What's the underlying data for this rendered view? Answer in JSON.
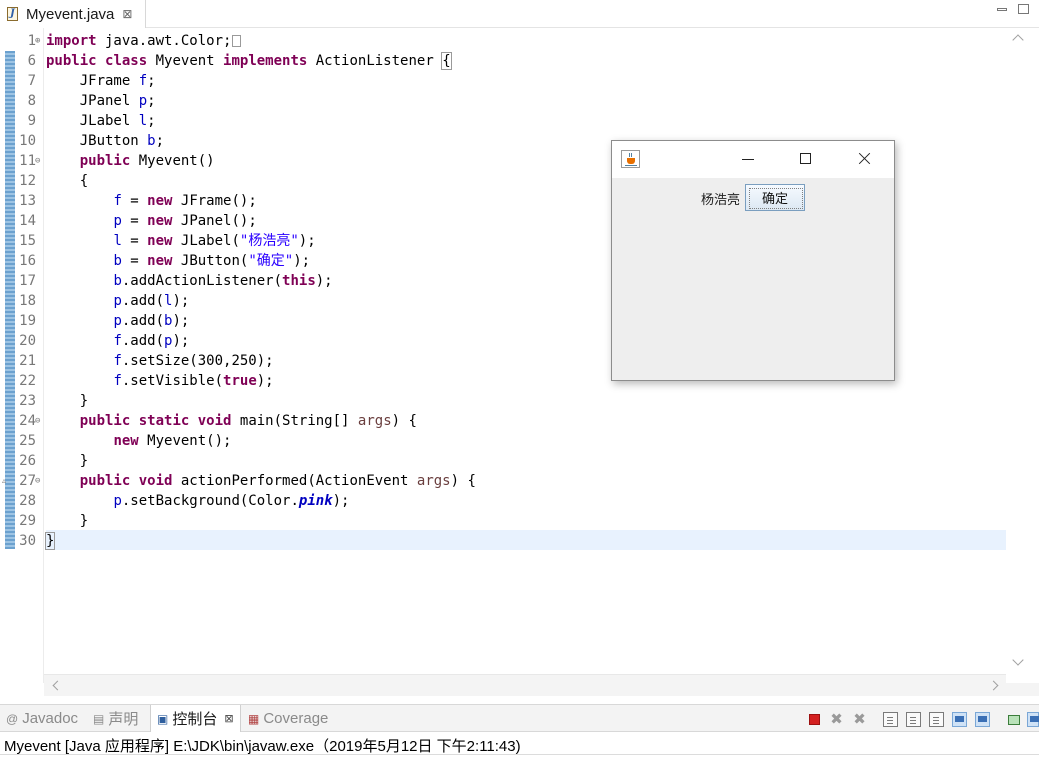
{
  "editor": {
    "tab_label": "Myevent.java",
    "tab_close": "⊠",
    "line_numbers": [
      "1",
      "6",
      "7",
      "8",
      "9",
      "10",
      "11",
      "12",
      "13",
      "14",
      "15",
      "16",
      "17",
      "18",
      "19",
      "20",
      "21",
      "22",
      "23",
      "24",
      "25",
      "26",
      "27",
      "28",
      "29",
      "30"
    ],
    "code": {
      "l1_kw": "import",
      "l1_rest": " java.awt.Color;",
      "l6_kw1": "public",
      "l6_kw2": "class",
      "l6_name": " Myevent ",
      "l6_kw3": "implements",
      "l6_iface": " ActionListener ",
      "l6_brace": "{",
      "l7_type": "JFrame ",
      "l7_var": "f",
      "l8_type": "JPanel ",
      "l8_var": "p",
      "l9_type": "JLabel ",
      "l9_var": "l",
      "l10_type": "JButton ",
      "l10_var": "b",
      "semi": ";",
      "kw_public": "public",
      "kw_new": "new",
      "kw_this": "this",
      "kw_true": "true",
      "kw_static": "static",
      "kw_void": "void",
      "l11_rest": " Myevent()",
      "open_brace": "{",
      "close_brace": "}",
      "var_f": "f",
      "var_p": "p",
      "var_l": "l",
      "var_b": "b",
      "assign": " = ",
      "l13_rest": " JFrame();",
      "l14_rest": " JPanel();",
      "l15_mid": " JLabel(",
      "l15_str": "\"杨浩亮\"",
      "l15_end": ");",
      "l16_mid": " JButton(",
      "l16_str": "\"确定\"",
      "l16_end": ");",
      "l17_mid": ".addActionListener(",
      "l17_end": ");",
      "l18_rest": ".add(",
      "l18_end": ");",
      "l20_rest": ".add(",
      "l20_end": ");",
      "l21_rest": ".setSize(300,250);",
      "l22_mid": ".setVisible(",
      "l22_end": ");",
      "l24_mid": " main(String[] ",
      "l24_param": "args",
      "l24_end": ") {",
      "l25_rest": " Myevent();",
      "l27_mid": " actionPerformed(ActionEvent ",
      "l27_param": "args",
      "l27_end": ") {",
      "l28_mid": ".setBackground(Color.",
      "l28_field": "pink",
      "l28_end": ");"
    }
  },
  "swing_window": {
    "label": "杨浩亮",
    "button": "确定"
  },
  "console": {
    "tabs": [
      {
        "icon": "@",
        "label": "Javadoc"
      },
      {
        "icon": "▤",
        "label": "声明"
      },
      {
        "icon": "▣",
        "label": "控制台"
      },
      {
        "icon": "▦",
        "label": "Coverage"
      }
    ],
    "close": "⊠",
    "status": "Myevent [Java 应用程序] E:\\JDK\\bin\\javaw.exe（2019年5月12日 下午2:11:43)"
  }
}
